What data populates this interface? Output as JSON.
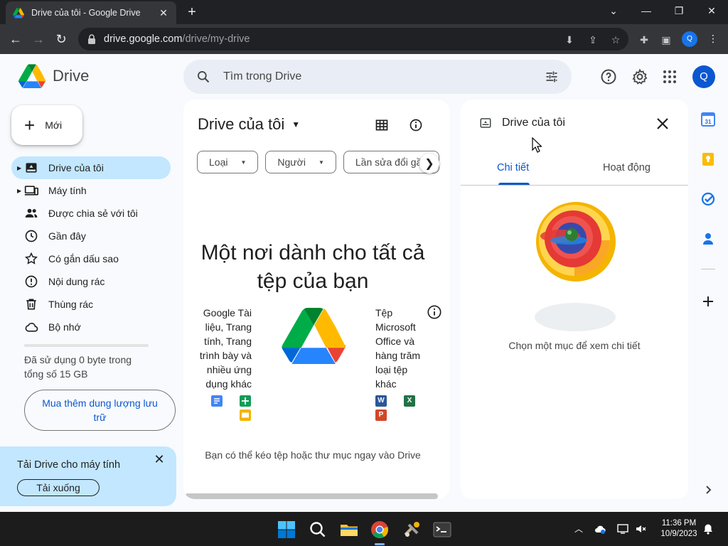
{
  "browser": {
    "tab_title": "Drive của tôi - Google Drive",
    "url_host": "drive.google.com",
    "url_path": "/drive/my-drive",
    "profile_initial": "Q"
  },
  "header": {
    "app_name": "Drive",
    "search_placeholder": "Tìm trong Drive",
    "account_initial": "Q"
  },
  "sidebar": {
    "new_label": "Mới",
    "items": [
      {
        "label": "Drive của tôi"
      },
      {
        "label": "Máy tính"
      },
      {
        "label": "Được chia sẻ với tôi"
      },
      {
        "label": "Gần đây"
      },
      {
        "label": "Có gắn dấu sao"
      },
      {
        "label": "Nội dung rác"
      },
      {
        "label": "Thùng rác"
      },
      {
        "label": "Bộ nhớ"
      }
    ],
    "storage_text": "Đã sử dụng 0 byte trong tổng số 15 GB",
    "storage_used_fraction": 0,
    "buy_storage": "Mua thêm dung lượng lưu trữ"
  },
  "promo": {
    "title": "Tải Drive cho máy tính",
    "download": "Tải xuống"
  },
  "main": {
    "title": "Drive của tôi",
    "filters": [
      "Loại",
      "Người",
      "Lần sửa đổi gần"
    ],
    "empty_title": "Một nơi dành cho tất cả tệp của bạn",
    "left_text": "Google Tài liệu, Trang tính, Trang trình bày và nhiều ứng dụng khác",
    "right_text": "Tệp Microsoft Office và hàng trăm loại tệp khác",
    "office_letters": {
      "word": "W",
      "excel": "X",
      "powerpoint": "P"
    },
    "drop_hint": "Bạn có thể kéo tệp hoặc thư mục ngay vào Drive"
  },
  "details": {
    "title": "Drive của tôi",
    "tabs": [
      "Chi tiết",
      "Hoạt động"
    ],
    "hint": "Chọn một mục để xem chi tiết"
  },
  "side_panel": {
    "calendar_day": "31"
  },
  "taskbar": {
    "time": "11:36 PM",
    "date": "10/9/2023"
  },
  "colors": {
    "accent_blue": "#0b57d0",
    "active_nav": "#c2e7ff",
    "page_bg": "#f8fafd"
  }
}
